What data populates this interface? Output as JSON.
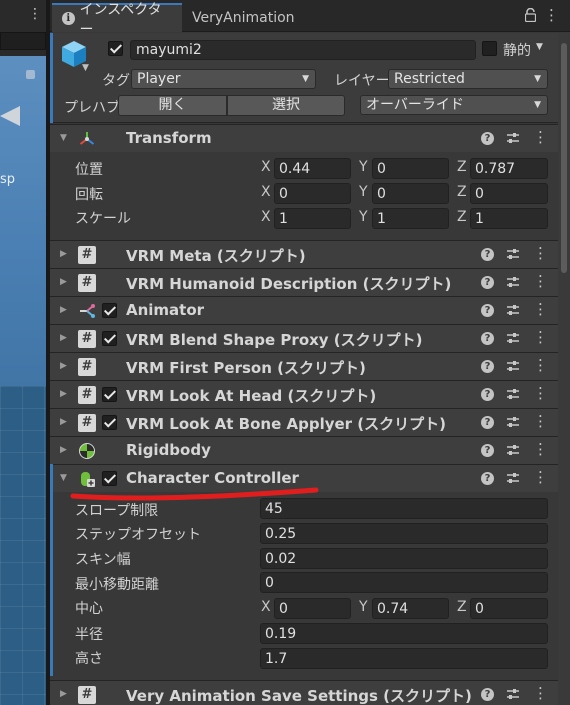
{
  "scene": {
    "side_text": "sp"
  },
  "tabs": [
    {
      "label": "インスペクター"
    },
    {
      "label": "VeryAnimation"
    }
  ],
  "header": {
    "name": "mayumi2",
    "static_label": "静的",
    "tag_label": "タグ",
    "tag_value": "Player",
    "layer_label": "レイヤー",
    "layer_value": "Restricted",
    "prefab_label": "プレハブ",
    "open_button": "開く",
    "select_button": "選択",
    "overrides_value": "オーバーライド"
  },
  "transform": {
    "title": "Transform",
    "rows": [
      {
        "label": "位置",
        "x": "0.44",
        "y": "0",
        "z": "0.787"
      },
      {
        "label": "回転",
        "x": "0",
        "y": "0",
        "z": "0"
      },
      {
        "label": "スケール",
        "x": "1",
        "y": "1",
        "z": "1"
      }
    ],
    "axis_x": "X",
    "axis_y": "Y",
    "axis_z": "Z"
  },
  "components": [
    {
      "title": "VRM Meta (スクリプト)",
      "icon": "script-icon",
      "has_checkbox": false
    },
    {
      "title": "VRM Humanoid Description (スクリプト)",
      "icon": "script-icon",
      "has_checkbox": false
    },
    {
      "title": "Animator",
      "icon": "animator-icon",
      "has_checkbox": true
    },
    {
      "title": "VRM Blend Shape Proxy (スクリプト)",
      "icon": "script-icon",
      "has_checkbox": true
    },
    {
      "title": "VRM First Person (スクリプト)",
      "icon": "script-icon",
      "has_checkbox": false
    },
    {
      "title": "VRM Look At Head (スクリプト)",
      "icon": "script-icon",
      "has_checkbox": true
    },
    {
      "title": "VRM Look At Bone Applyer (スクリプト)",
      "icon": "script-icon",
      "has_checkbox": true
    },
    {
      "title": "Rigidbody",
      "icon": "rigidbody-icon",
      "has_checkbox": false
    }
  ],
  "character_controller": {
    "title": "Character Controller",
    "slope_label": "スロープ制限",
    "slope_value": "45",
    "step_label": "ステップオフセット",
    "step_value": "0.25",
    "skin_label": "スキン幅",
    "skin_value": "0.02",
    "min_move_label": "最小移動距離",
    "min_move_value": "0",
    "center_label": "中心",
    "center_x": "0",
    "center_y": "0.74",
    "center_z": "0",
    "radius_label": "半径",
    "radius_value": "0.19",
    "height_label": "高さ",
    "height_value": "1.7"
  },
  "very_animation_settings": {
    "title": "Very Animation Save Settings (スクリプト)"
  },
  "colors": {
    "accent": "#3a79bb",
    "annotation": "#e01e1e",
    "panel": "#383838"
  }
}
